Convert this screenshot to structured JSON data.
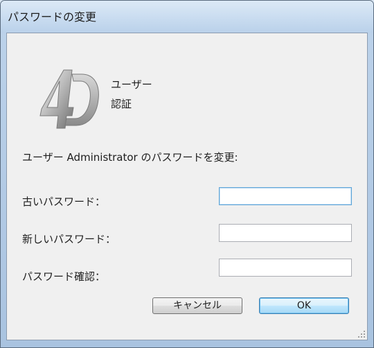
{
  "window": {
    "title": "パスワードの変更"
  },
  "auth": {
    "line1": "ユーザー",
    "line2": "認証"
  },
  "prompt": "ユーザー Administrator のパスワードを変更:",
  "fields": [
    {
      "label": "古いパスワード：",
      "value": ""
    },
    {
      "label": "新しいパスワード：",
      "value": ""
    },
    {
      "label": "パスワード確認：",
      "value": ""
    }
  ],
  "buttons": {
    "cancel": "キャンセル",
    "ok": "OK"
  },
  "logo": {
    "text": "4D"
  }
}
